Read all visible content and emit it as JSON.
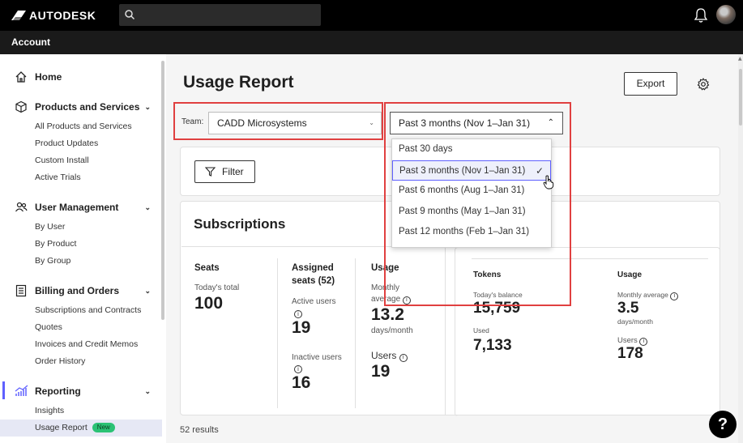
{
  "header": {
    "brand": "AUTODESK",
    "account_label": "Account"
  },
  "sidebar": {
    "sections": [
      {
        "label": "Home",
        "items": []
      },
      {
        "label": "Products and Services",
        "items": [
          "All Products and Services",
          "Product Updates",
          "Custom Install",
          "Active Trials"
        ]
      },
      {
        "label": "User Management",
        "items": [
          "By User",
          "By Product",
          "By Group"
        ]
      },
      {
        "label": "Billing and Orders",
        "items": [
          "Subscriptions and Contracts",
          "Quotes",
          "Invoices and Credit Memos",
          "Order History"
        ]
      },
      {
        "label": "Reporting",
        "items": [
          "Insights",
          "Usage Report"
        ]
      }
    ],
    "new_badge": "New"
  },
  "main": {
    "title": "Usage Report",
    "export_label": "Export",
    "team_label": "Team:",
    "team_value": "CADD Microsystems",
    "date_value": "Past 3 months (Nov 1–Jan 31)",
    "date_options": [
      "Past 30 days",
      "Past 3 months (Nov 1–Jan 31)",
      "Past 6 months (Aug 1–Jan 31)",
      "Past 9 months (May 1–Jan 31)",
      "Past 12 months (Feb 1–Jan 31)"
    ],
    "selected_option": 1,
    "filter_label": "Filter",
    "subscriptions": {
      "title": "Subscriptions",
      "seats_label": "Seats",
      "todays_total_label": "Today's total",
      "todays_total": "100",
      "assigned_label": "Assigned",
      "assigned_label2": "seats (52)",
      "active_users_label": "Active users",
      "active_users": "19",
      "inactive_users_label": "Inactive users",
      "inactive_users": "16",
      "usage_label": "Usage",
      "monthly_label": "Monthly",
      "average_label": "average",
      "monthly_average": "13.2",
      "days_month": "days/month",
      "users_label": "Users",
      "users": "19"
    },
    "tokens": {
      "tokens_label": "Tokens",
      "balance_label": "Today's balance",
      "balance": "15,759",
      "used_label": "Used",
      "used": "7,133",
      "usage_label": "Usage",
      "monthly_average_label": "Monthly average",
      "monthly_average": "3.5",
      "days_month": "days/month",
      "users_label": "Users",
      "users": "178"
    },
    "results": "52 results",
    "help": "?"
  }
}
